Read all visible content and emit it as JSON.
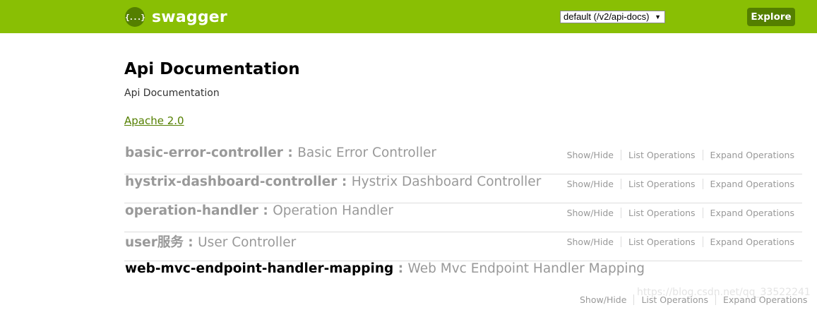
{
  "header": {
    "logo_icon": "{...}",
    "logo_text": "swagger",
    "spec_select": {
      "selected": "default (/v2/api-docs)",
      "caret": "▼"
    },
    "explore_label": "Explore",
    "colors": {
      "bar": "#89bf04",
      "accent": "#547f00"
    }
  },
  "info": {
    "title": "Api Documentation",
    "description": "Api Documentation",
    "license": "Apache 2.0"
  },
  "resources": [
    {
      "path": "basic-error-controller",
      "separator": " : ",
      "description": "Basic Error Controller"
    },
    {
      "path": "hystrix-dashboard-controller",
      "separator": " : ",
      "description": "Hystrix Dashboard Controller"
    },
    {
      "path": "operation-handler",
      "separator": " : ",
      "description": "Operation Handler"
    },
    {
      "path": "user服务",
      "separator": " : ",
      "description": "User Controller"
    },
    {
      "path": "web-mvc-endpoint-handler-mapping",
      "separator": " : ",
      "description": "Web Mvc Endpoint Handler Mapping"
    }
  ],
  "operations": {
    "show_hide": "Show/Hide",
    "list": "List Operations",
    "expand": "Expand Operations"
  },
  "watermark": "https://blog.csdn.net/qq_33522241"
}
